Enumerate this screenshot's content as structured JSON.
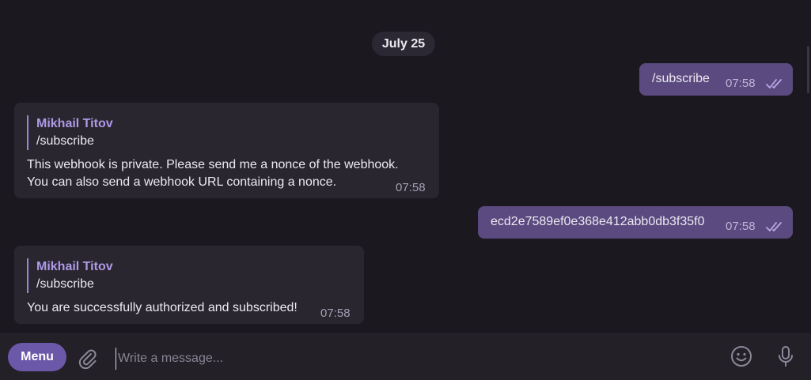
{
  "date_separator": "July 25",
  "messages": [
    {
      "direction": "out",
      "text": "/subscribe",
      "time": "07:58",
      "status": "read"
    },
    {
      "direction": "in",
      "reply": {
        "name": "Mikhail Titov",
        "text": "/subscribe"
      },
      "lines": [
        "This webhook is private. Please send me a nonce of the webhook.",
        "You can also send a webhook URL containing a nonce."
      ],
      "time": "07:58"
    },
    {
      "direction": "out",
      "text": "ecd2e7589ef0e368e412abb0db3f35f0",
      "time": "07:58",
      "status": "read"
    },
    {
      "direction": "in",
      "reply": {
        "name": "Mikhail Titov",
        "text": "/subscribe"
      },
      "lines": [
        "You are successfully authorized and subscribed!"
      ],
      "time": "07:58"
    }
  ],
  "composer": {
    "menu_label": "Menu",
    "placeholder": "Write a message..."
  },
  "icons": {
    "attach": "paperclip-icon",
    "emoji": "emoji-icon",
    "mic": "microphone-icon",
    "read_status": "double-check-icon"
  },
  "colors": {
    "background": "#1b1820",
    "outgoing_bubble": "#5a4a80",
    "incoming_bubble": "#2a2630",
    "accent": "#6c58a8",
    "reply_name": "#ae9ae6"
  }
}
